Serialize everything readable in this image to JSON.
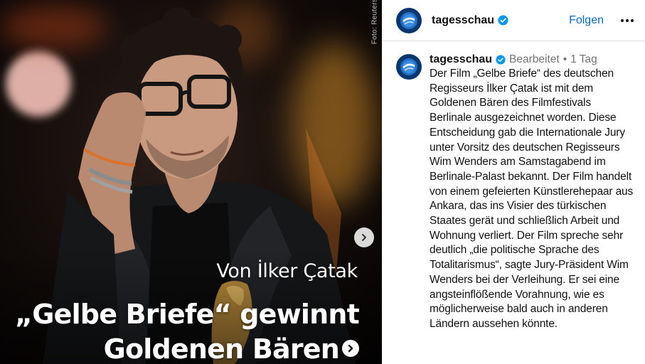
{
  "media": {
    "photo_credit": "Foto: Reuters",
    "overlay_subtitle": "Von İlker Çatak",
    "overlay_title_line1": "„Gelbe Briefe“ gewinnt",
    "overlay_title_line2": "Goldenen Bären",
    "next_icon": "chevron-right-icon"
  },
  "header": {
    "username": "tagesschau",
    "follow_label": "Folgen",
    "more_icon": "ellipsis-icon"
  },
  "caption": {
    "username": "tagesschau",
    "edited_label": "Bearbeitet",
    "separator": "•",
    "time": "1 Tag",
    "text": "Der Film „Gelbe Briefe“ des deutschen Regisseurs İlker Çatak ist mit dem Goldenen Bären des Filmfestivals Berlinale ausgezeichnet worden. Diese Entscheidung gab die Internationale Jury unter Vorsitz des deutschen Regisseurs Wim Wenders am Samstagabend im Berlinale-Palast bekannt. Der Film handelt von einem gefeierten Künstlerehepaar aus Ankara, das ins Visier des türkischen Staates gerät und schließlich Arbeit und Wohnung verliert. Der Film spreche sehr deutlich „die politische Sprache des Totalitarismus“, sagte Jury-Präsident Wim Wenders bei der Verleihung. Er sei eine angsteinflößende Vorahnung, wie es möglicherweise bald auch in anderen Ländern aussehen könnte."
  },
  "colors": {
    "link_blue": "#0a66c2",
    "verified_blue": "#0095f6",
    "brand_navy": "#0a3670",
    "muted_text": "#737373"
  }
}
